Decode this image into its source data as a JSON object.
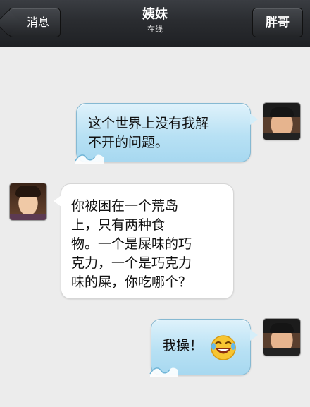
{
  "header": {
    "back_label": "消息",
    "contact_name": "姨妹",
    "status": "在线",
    "right_label": "胖哥"
  },
  "messages": [
    {
      "side": "right",
      "text_lines": [
        "这个世界上没有我解",
        "不开的问题。"
      ]
    },
    {
      "side": "left",
      "text_lines": [
        "你被困在一个荒岛",
        "上，只有两种食",
        "物。一个是屎味的巧",
        "克力，一个是巧克力",
        "味的屎，你吃哪个？"
      ]
    },
    {
      "side": "right",
      "text": "我操！",
      "emoji": "laughing-tears-emoji"
    }
  ],
  "colors": {
    "header_bg": "#2a2c30",
    "chat_bg": "#ececec",
    "sent_bubble": "#b8e1f4",
    "received_bubble": "#ffffff"
  }
}
